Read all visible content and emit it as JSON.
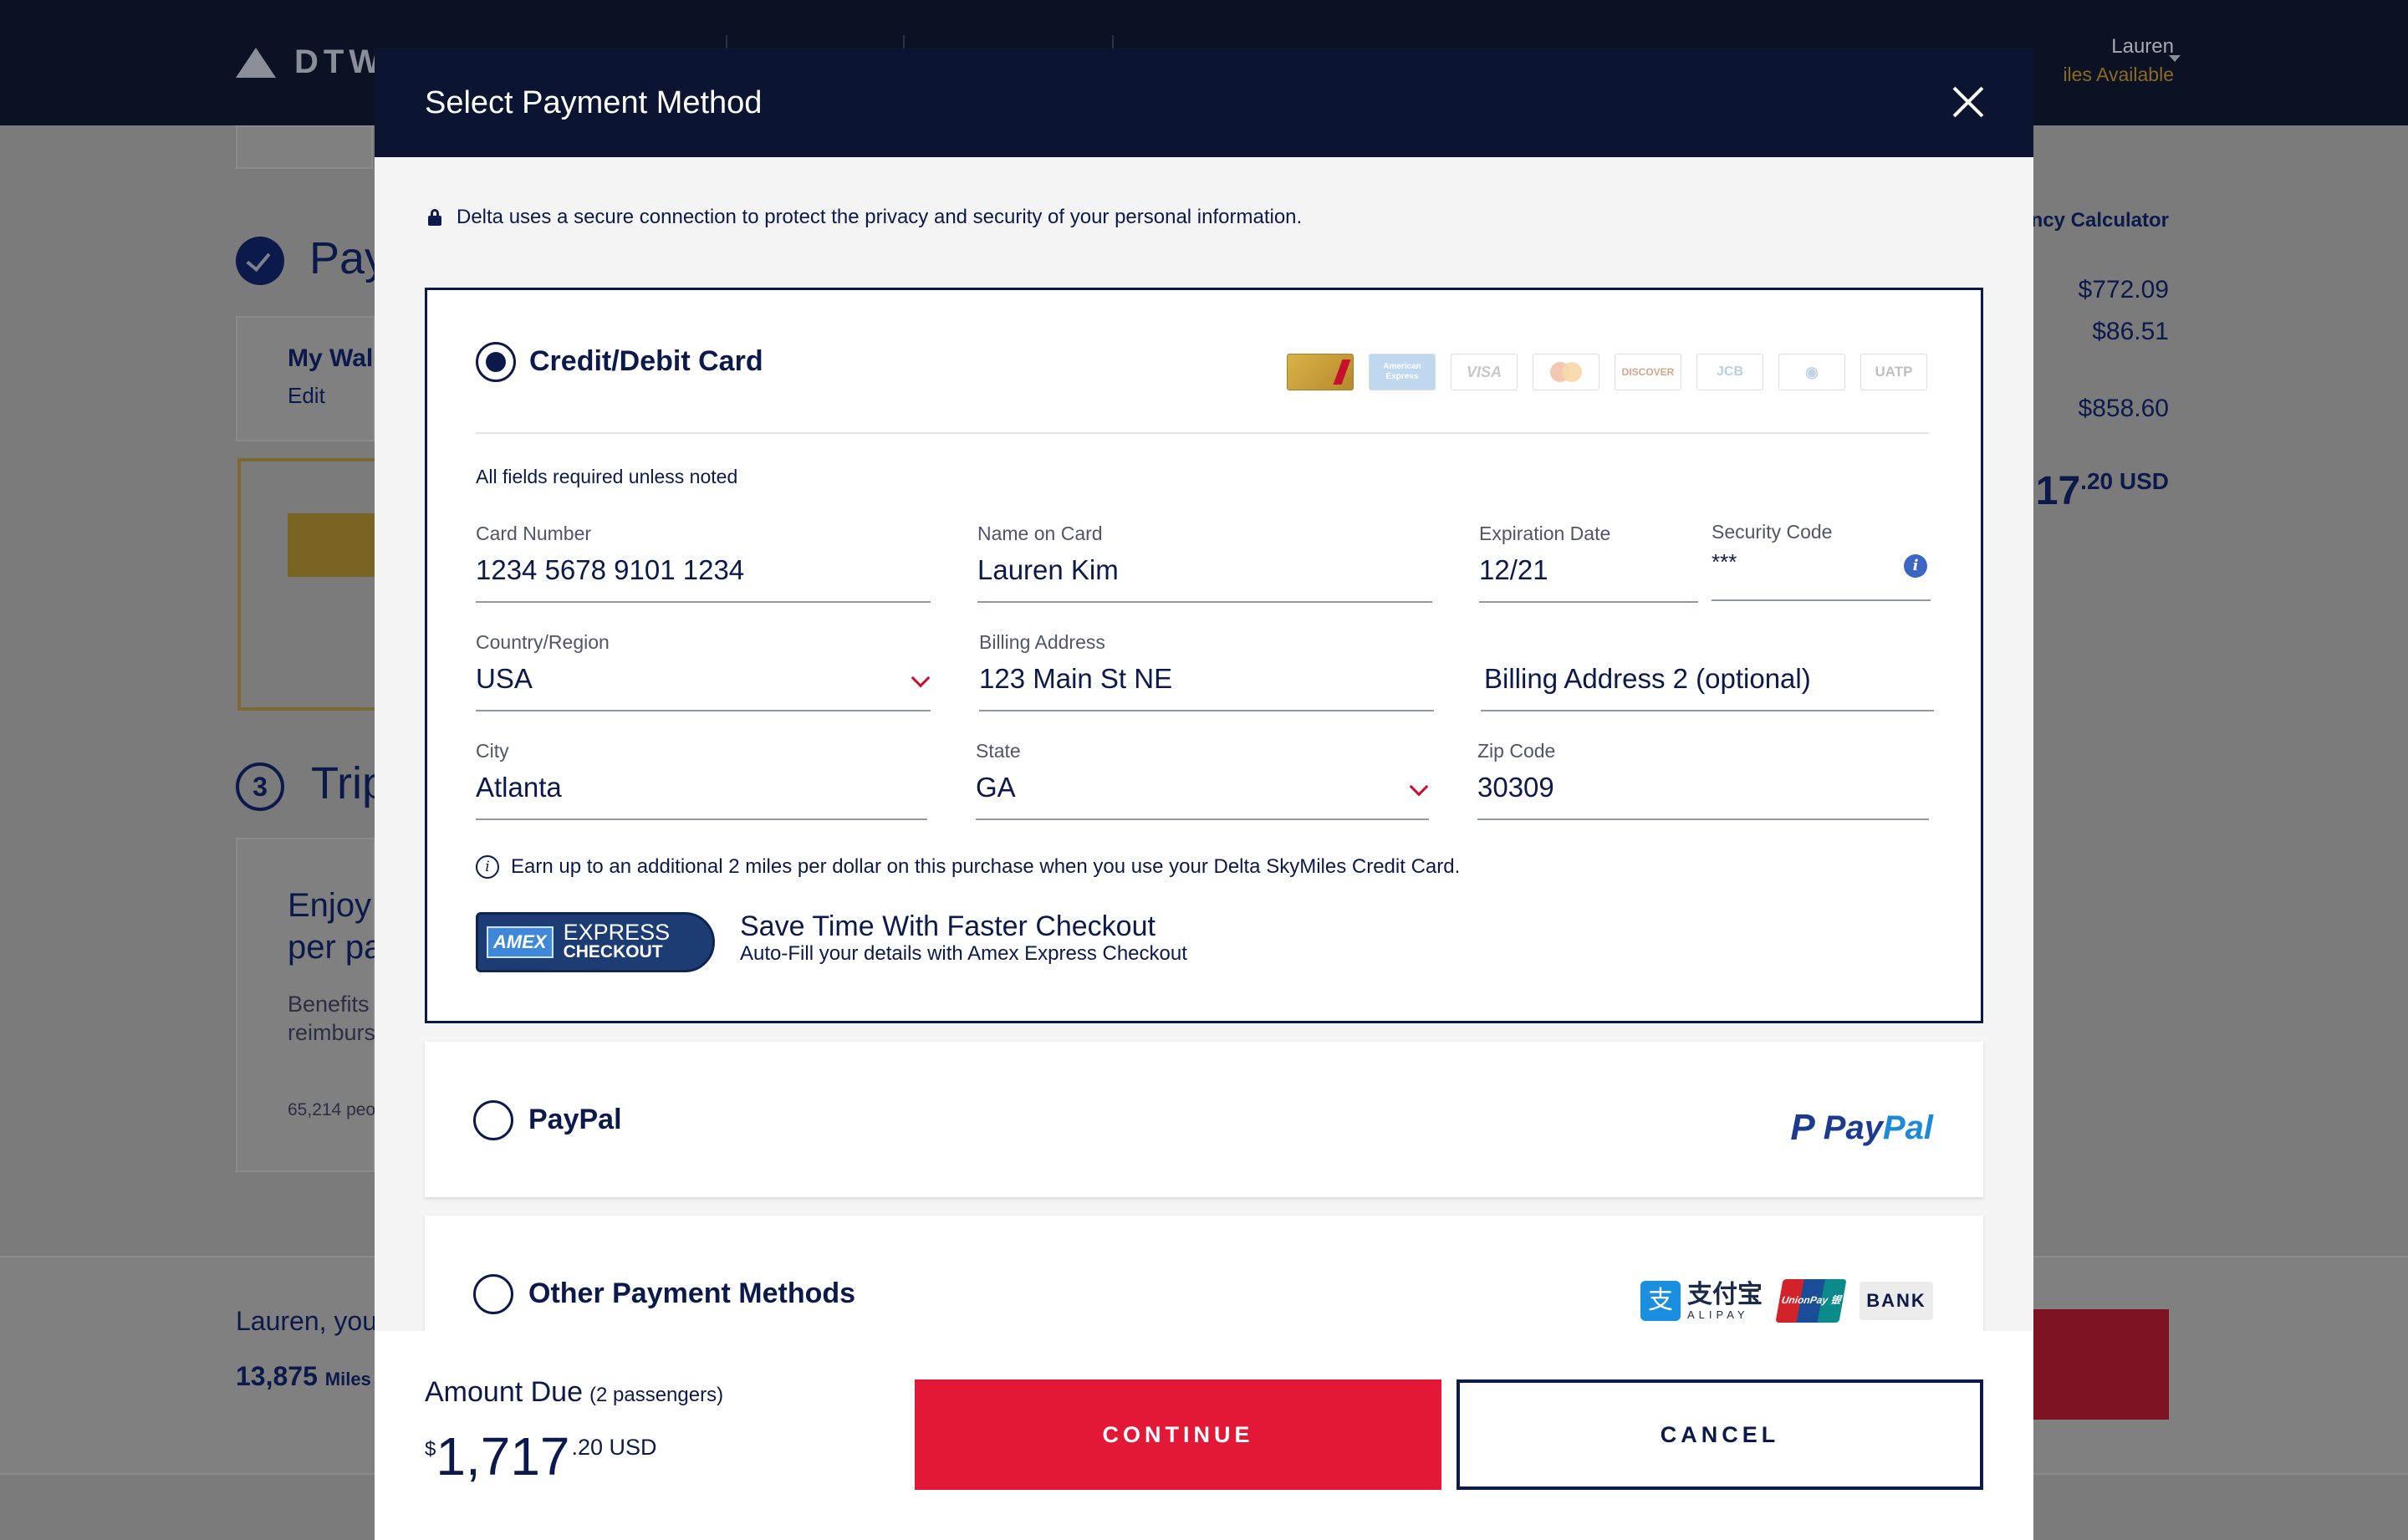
{
  "background": {
    "brand": "DTW",
    "user_name": "Lauren",
    "user_miles": "iles Available",
    "section_pay": "Pay",
    "my_wallet": "My Wal",
    "edit": "Edit",
    "section_number": "3",
    "section_trip": "Trip",
    "enjoy_line1": "Enjoy",
    "enjoy_line2": "per pa",
    "benefits_line1": "Benefits",
    "benefits_line2": "reimburs",
    "people": "65,214 peo",
    "calculator_link": "ency Calculator",
    "price1": "$772.09",
    "price2": "$86.51",
    "price3": "$858.60",
    "total_int": "17",
    "total_dec": ".20 USD",
    "greeting": "Lauren, you",
    "miles_value": "13,875",
    "miles_unit": "Miles"
  },
  "modal": {
    "title": "Select Payment Method",
    "secure_text": "Delta uses a secure connection to protect the privacy and security of your personal information.",
    "credit_card": {
      "label": "Credit/Debit Card",
      "selected": true,
      "logos": [
        "gold-skymiles-card",
        "American Express",
        "VISA",
        "mastercard",
        "DISCOVER",
        "JCB",
        "Diners Club",
        "UATP"
      ],
      "required_note": "All fields required unless noted",
      "fields": {
        "card_number": {
          "label": "Card Number",
          "value": "1234 5678 9101 1234"
        },
        "name_on_card": {
          "label": "Name on Card",
          "value": "Lauren Kim"
        },
        "expiration": {
          "label": "Expiration Date",
          "value": "12/21"
        },
        "security_code": {
          "label": "Security Code",
          "value": "***"
        },
        "country": {
          "label": "Country/Region",
          "value": "USA"
        },
        "billing_address": {
          "label": "Billing Address",
          "value": "123 Main St NE"
        },
        "billing_address2": {
          "placeholder": "Billing Address 2 (optional)"
        },
        "city": {
          "label": "City",
          "value": "Atlanta"
        },
        "state": {
          "label": "State",
          "value": "GA"
        },
        "zip": {
          "label": "Zip Code",
          "value": "30309"
        }
      },
      "earn_text": "Earn up to an additional 2 miles per dollar on this purchase when you use your Delta SkyMiles Credit Card.",
      "amex_badge": {
        "box": "AMEX",
        "line1": "EXPRESS",
        "line2": "CHECKOUT"
      },
      "express_title": "Save Time With Faster Checkout",
      "express_sub": "Auto-Fill your details with Amex Express Checkout"
    },
    "paypal": {
      "label": "PayPal",
      "logo_a": "Pay",
      "logo_b": "Pal",
      "logo_mark": "P"
    },
    "other": {
      "label": "Other Payment Methods",
      "alipay_cn": "支付宝",
      "alipay_en": "ALIPAY",
      "unionpay": "UnionPay 银联",
      "bank": "BANK"
    },
    "footer": {
      "amount_label": "Amount Due",
      "passengers": "(2 passengers)",
      "currency_symbol": "$",
      "amount_int": "1,717",
      "amount_dec": ".20 USD",
      "continue": "CONTINUE",
      "cancel": "CANCEL"
    }
  },
  "colors": {
    "navy": "#0b1a4a",
    "header": "#0b1430",
    "red": "#e31837",
    "overlay": "#7b7b7b"
  }
}
